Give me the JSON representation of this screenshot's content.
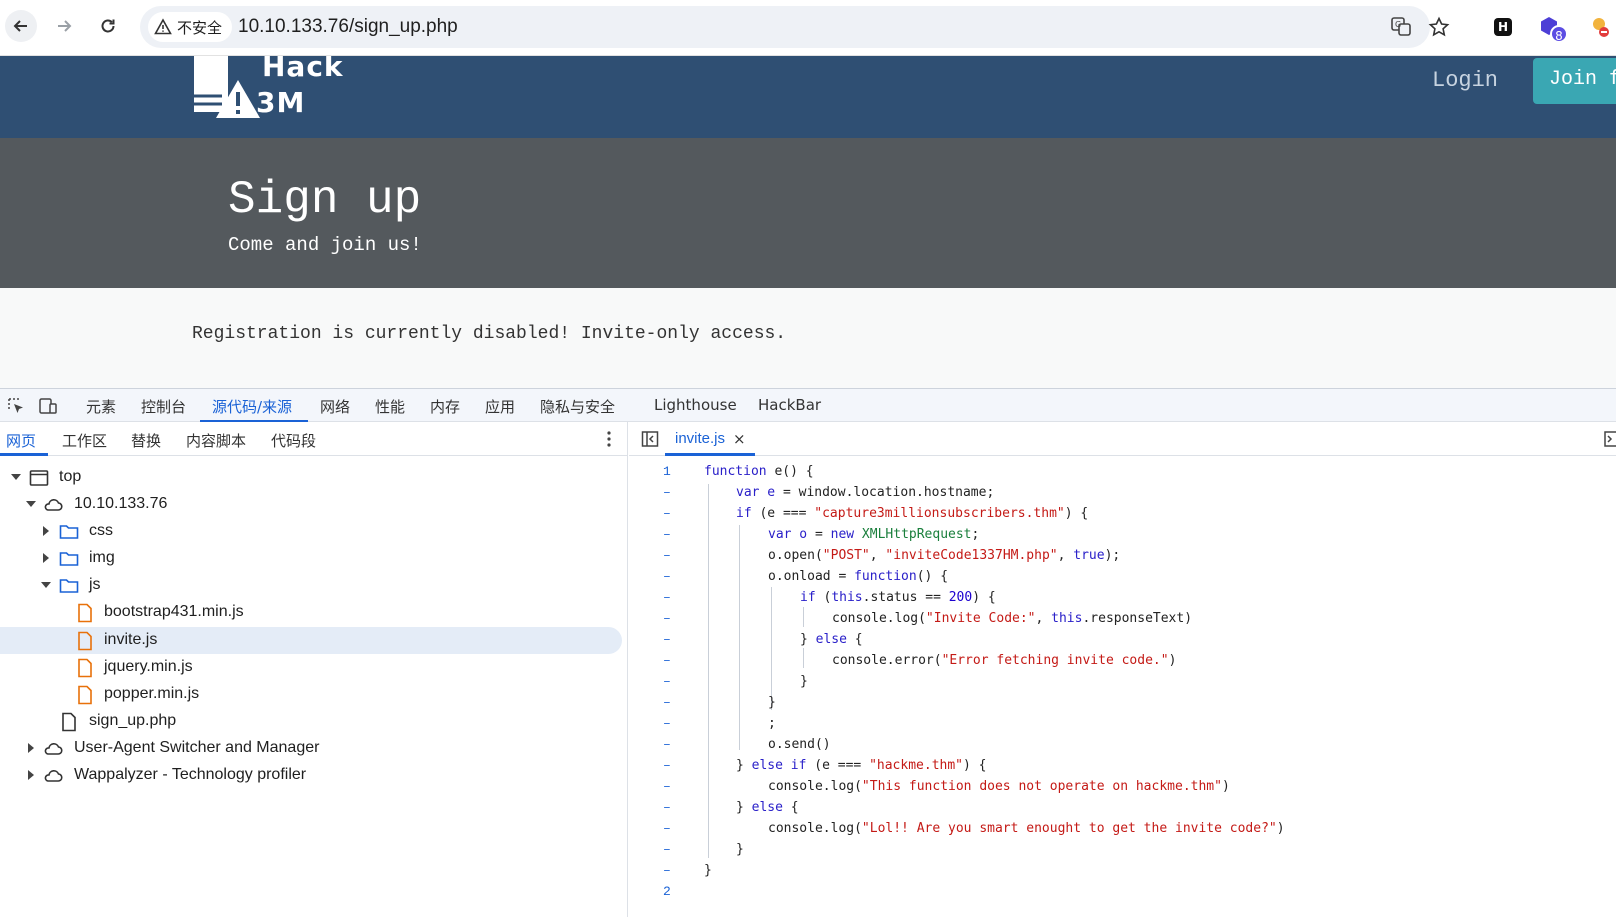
{
  "browser": {
    "security_label": "不安全",
    "url": "10.10.133.76/sign_up.php",
    "extension_badge": "8",
    "extension_h_label": "H"
  },
  "site": {
    "logo_line1": "Hack",
    "logo_line2": "3M",
    "nav_login": "Login",
    "nav_join": "Join fo",
    "hero_title": "Sign up",
    "hero_subtitle": "Come and join us!",
    "message": "Registration is currently disabled! Invite-only access.",
    "colors": {
      "navbar": "#2f4f73",
      "hero": "#54595d",
      "join_button": "#3aa7b3"
    }
  },
  "devtools": {
    "tabs": [
      "元素",
      "控制台",
      "源代码/来源",
      "网络",
      "性能",
      "内存",
      "应用",
      "隐私与安全",
      "Lighthouse",
      "HackBar"
    ],
    "active_tab": "源代码/来源",
    "nav_subtabs": [
      "网页",
      "工作区",
      "替换",
      "内容脚本",
      "代码段"
    ],
    "tree": {
      "top": "top",
      "host": "10.10.133.76",
      "css": "css",
      "img": "img",
      "js": "js",
      "file_bootstrap": "bootstrap431.min.js",
      "file_invite": "invite.js",
      "file_jquery": "jquery.min.js",
      "file_popper": "popper.min.js",
      "file_signup": "sign_up.php",
      "ext_useragent": "User-Agent Switcher and Manager",
      "ext_wappalyzer": "Wappalyzer - Technology profiler"
    },
    "editor": {
      "open_file": "invite.js",
      "close_glyph": "×",
      "line_first": "1",
      "line_last": "2",
      "line_dash": "–",
      "code": {
        "l1_kw": "function",
        "l1_rest": " e() {",
        "l2_kw": "var",
        "l2_var": " e",
        "l2_rest": " = window.location.hostname;",
        "l3_kw": "if",
        "l3_a": " (e === ",
        "l3_str": "\"capture3millionsubscribers.thm\"",
        "l3_b": ") {",
        "l4_kw": "var",
        "l4_var": " o",
        "l4_a": " = ",
        "l4_new": "new",
        "l4_type": " XMLHttpRequest",
        "l4_b": ";",
        "l5_a": "o.open(",
        "l5_s1": "\"POST\"",
        "l5_b": ", ",
        "l5_s2": "\"inviteCode1337HM.php\"",
        "l5_c": ", ",
        "l5_kw": "true",
        "l5_d": ");",
        "l6_a": "o.onload = ",
        "l6_kw": "function",
        "l6_b": "() {",
        "l7_kw": "if",
        "l7_a": " (",
        "l7_this": "this",
        "l7_b": ".status == ",
        "l7_num": "200",
        "l7_c": ") {",
        "l8_a": "console.log(",
        "l8_str": "\"Invite Code:\"",
        "l8_b": ", ",
        "l8_this": "this",
        "l8_c": ".responseText)",
        "l9_a": "} ",
        "l9_kw": "else",
        "l9_b": " {",
        "l10_a": "console.error(",
        "l10_str": "\"Error fetching invite code.\"",
        "l10_b": ")",
        "l11": "}",
        "l12": "}",
        "l13": ";",
        "l14": "o.send()",
        "l15_a": "} ",
        "l15_kw1": "else",
        "l15_b": " ",
        "l15_kw2": "if",
        "l15_c": " (e === ",
        "l15_str": "\"hackme.thm\"",
        "l15_d": ") {",
        "l16_a": "console.log(",
        "l16_str": "\"This function does not operate on hackme.thm\"",
        "l16_b": ")",
        "l17_a": "} ",
        "l17_kw": "else",
        "l17_b": " {",
        "l18_a": "console.log(",
        "l18_str": "\"Lol!! Are you smart enought to get the invite code?\"",
        "l18_b": ")",
        "l19": "}",
        "l20": "}"
      }
    }
  }
}
